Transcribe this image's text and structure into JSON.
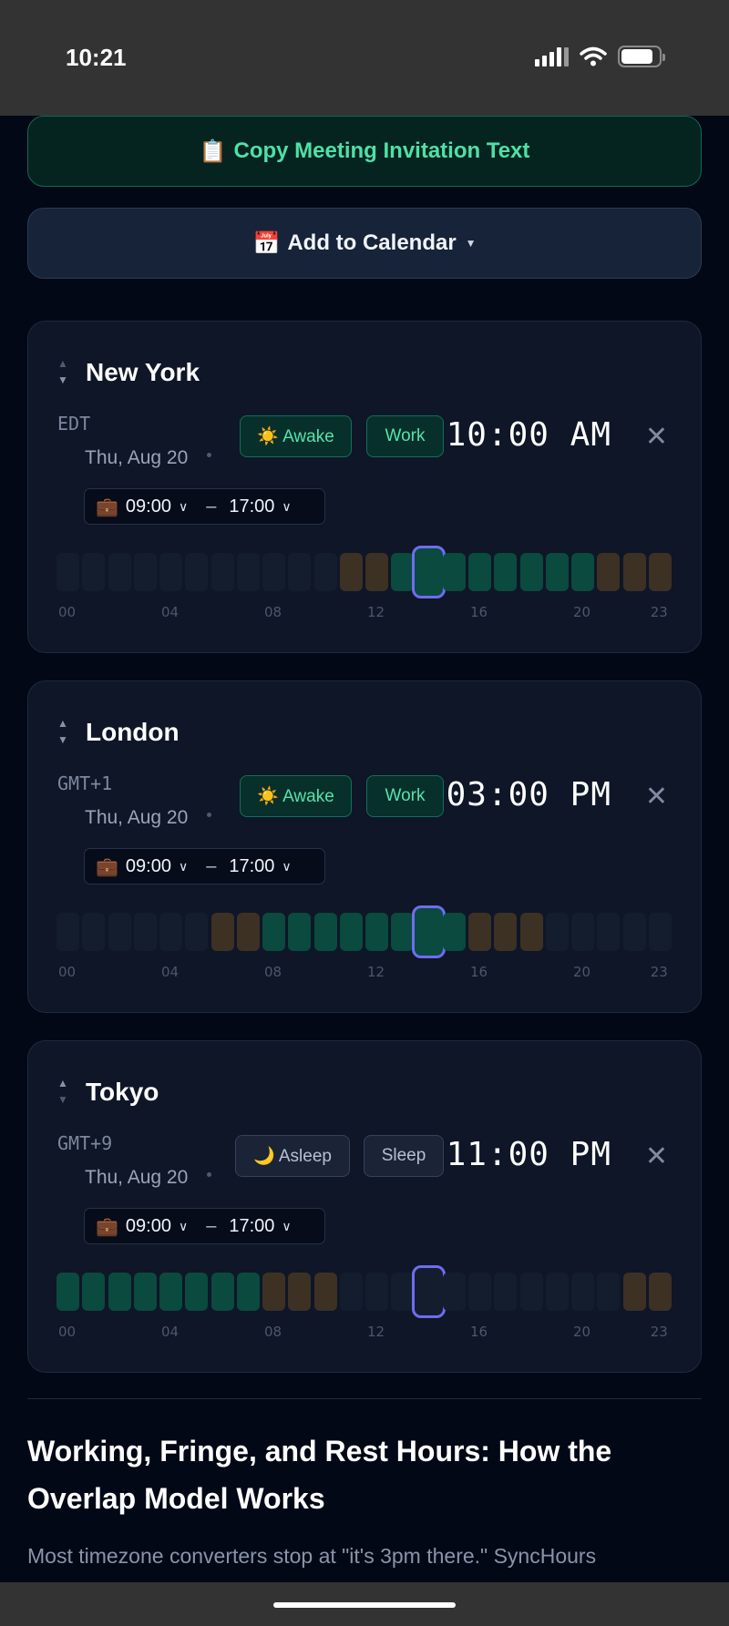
{
  "status_bar": {
    "time": "10:21"
  },
  "actions": {
    "copy_icon": "📋",
    "copy_label": "Copy Meeting Invitation Text",
    "calendar_icon": "📅",
    "calendar_label": "Add to Calendar"
  },
  "hour_labels": [
    "00",
    "04",
    "08",
    "12",
    "16",
    "20",
    "23"
  ],
  "cards": [
    {
      "city": "New York",
      "tz": "EDT",
      "date": "Thu, Aug 20",
      "status_label": "☀️ Awake",
      "status_kind": "awake",
      "period": "Work",
      "time": "10:00 AM",
      "work_start": "09:00",
      "work_end": "17:00",
      "current_hour": 14,
      "hours": [
        "rest",
        "rest",
        "rest",
        "rest",
        "rest",
        "rest",
        "rest",
        "rest",
        "rest",
        "rest",
        "rest",
        "fringe",
        "fringe",
        "work",
        "work",
        "work",
        "work",
        "work",
        "work",
        "work",
        "work",
        "fringe",
        "fringe",
        "fringe"
      ]
    },
    {
      "city": "London",
      "tz": "GMT+1",
      "date": "Thu, Aug 20",
      "status_label": "☀️ Awake",
      "status_kind": "awake",
      "period": "Work",
      "time": "03:00 PM",
      "work_start": "09:00",
      "work_end": "17:00",
      "current_hour": 14,
      "hours": [
        "rest",
        "rest",
        "rest",
        "rest",
        "rest",
        "rest",
        "fringe",
        "fringe",
        "work",
        "work",
        "work",
        "work",
        "work",
        "work",
        "work",
        "work",
        "fringe",
        "fringe",
        "fringe",
        "rest",
        "rest",
        "rest",
        "rest",
        "rest"
      ]
    },
    {
      "city": "Tokyo",
      "tz": "GMT+9",
      "date": "Thu, Aug 20",
      "status_label": "🌙 Asleep",
      "status_kind": "sleep",
      "period": "Sleep",
      "time": "11:00 PM",
      "work_start": "09:00",
      "work_end": "17:00",
      "current_hour": 14,
      "hours": [
        "work",
        "work",
        "work",
        "work",
        "work",
        "work",
        "work",
        "work",
        "fringe",
        "fringe",
        "fringe",
        "rest",
        "rest",
        "rest",
        "rest",
        "rest",
        "rest",
        "rest",
        "rest",
        "rest",
        "rest",
        "rest",
        "fringe",
        "fringe"
      ]
    }
  ],
  "article": {
    "heading": "Working, Fringe, and Rest Hours: How the Overlap Model Works",
    "paragraph": "Most timezone converters stop at \"it's 3pm there.\" SyncHours"
  },
  "colors": {
    "work": "#0a4a3f",
    "fringe": "#3d3124",
    "rest": "#141d2d",
    "current": "#6f6cf0"
  }
}
